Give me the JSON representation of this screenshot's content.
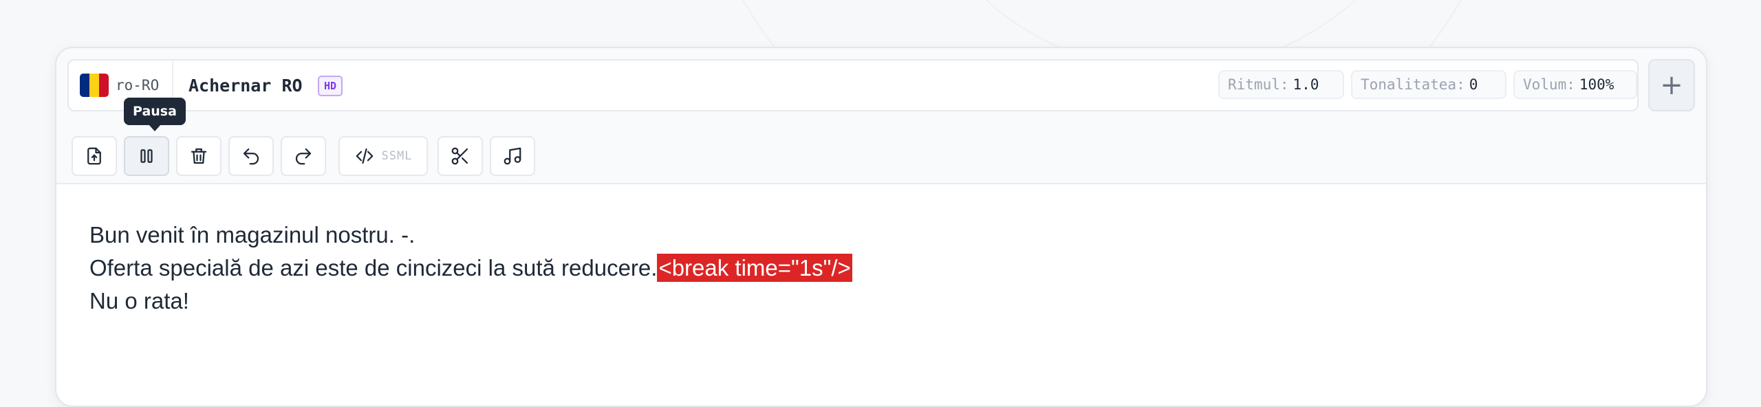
{
  "voice": {
    "language_code": "ro-RO",
    "flag_colors": [
      "#002B7F",
      "#FCD116",
      "#CE1126"
    ],
    "name": "Achernar RO",
    "quality_badge": "HD"
  },
  "params": {
    "rate": {
      "label": "Ritmul:",
      "value": "1.0"
    },
    "pitch": {
      "label": "Tonalitatea:",
      "value": "0"
    },
    "volume": {
      "label": "Volum:",
      "value": "100%"
    }
  },
  "add_label": "+",
  "toolbar": {
    "tooltip": "Pausa",
    "ssml_label": "SSML",
    "icons": [
      "upload-icon",
      "pause-icon",
      "trash-icon",
      "undo-icon",
      "redo-icon",
      "code-icon",
      "scissors-icon",
      "music-icon"
    ]
  },
  "editor": {
    "lines": [
      {
        "text": "Bun venit în magazinul nostru. -.",
        "tag": ""
      },
      {
        "text": "Oferta specială de azi este de cincizeci la sută reducere.",
        "tag": "<break time=\"1s\"/>"
      },
      {
        "text": "Nu o rata!",
        "tag": ""
      }
    ],
    "tag_color": "#dc2626"
  }
}
